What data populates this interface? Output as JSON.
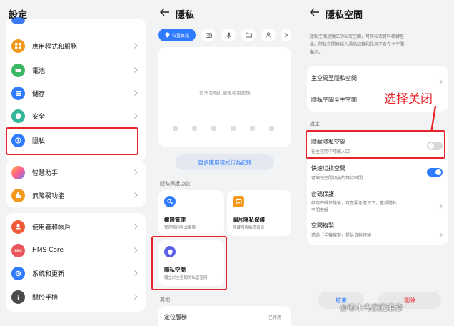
{
  "panel_settings": {
    "title": "設定",
    "items": [
      {
        "label": "應用程式和服務",
        "icon": "apps-icon",
        "color": "#f39a1e"
      },
      {
        "label": "電池",
        "icon": "battery-icon",
        "color": "#3cb763"
      },
      {
        "label": "儲存",
        "icon": "storage-icon",
        "color": "#2f7bff"
      },
      {
        "label": "安全",
        "icon": "shield-icon",
        "color": "#33b59a"
      },
      {
        "label": "隱私",
        "icon": "privacy-icon",
        "color": "#2f7bff"
      },
      {
        "label": "智慧助手",
        "icon": "assistant-icon",
        "color": "#ff6b8a"
      },
      {
        "label": "無障礙功能",
        "icon": "accessibility-icon",
        "color": "#f39a1e"
      },
      {
        "label": "使用者和帳戶",
        "icon": "user-icon",
        "color": "#ef5b3a"
      },
      {
        "label": "HMS Core",
        "icon": "hms-icon",
        "color": "#e8555b"
      },
      {
        "label": "系統和更新",
        "icon": "system-icon",
        "color": "#2f7bff"
      },
      {
        "label": "關於手機",
        "icon": "info-icon",
        "color": "#4a4a4a"
      }
    ]
  },
  "panel_privacy": {
    "title": "隱私",
    "chips": [
      {
        "label": "位置資訊",
        "icon": "location-icon"
      },
      {
        "icon": "camera-icon"
      },
      {
        "icon": "microphone-icon"
      },
      {
        "icon": "folder-icon"
      },
      {
        "icon": "contacts-icon"
      },
      {
        "icon": "chevron-right-icon"
      }
    ],
    "empty_text": "暫未發現此權限使用記錄",
    "more_button": "更多應用程式行為記錄",
    "section_protect": "隱私保護功能",
    "features": [
      {
        "title": "權限管理",
        "subtitle": "管理應用程式權限",
        "icon": "key-icon",
        "color": "#2f7bff"
      },
      {
        "title": "圖片隱私保護",
        "subtitle": "隱藏圖片敏感資訊",
        "icon": "image-icon",
        "color": "#f39a1e"
      },
      {
        "title": "隱私空間",
        "subtitle": "獨立於主空間的私密空間",
        "icon": "shield-icon",
        "color": "#5b5fe8"
      }
    ],
    "section_other": "其他",
    "location_row": {
      "label": "定位服務",
      "value": "已停用"
    }
  },
  "panel_space": {
    "title": "隱私空間",
    "intro": [
      "隱私空間是獨立的私密空間，可將私密資料移轉至",
      "此。隱私空間聯絡人通話記錄和訊息不會在主空間",
      "顯示。"
    ],
    "switch_rows": [
      "主空間至隱私空間",
      "隱私空間至主空間"
    ],
    "section_settings": "設定",
    "settings": [
      {
        "title": "隱藏隱私空間",
        "subtitle": "在主空間中隱藏入口",
        "toggle": false
      },
      {
        "title": "快速切換空間",
        "subtitle": "可縮短空間切換的等待時間",
        "toggle": true
      },
      {
        "title": "密碼保護",
        "subtitle": [
          "啟用密碼保護後，可在緊急情況下，重設隱私",
          "空間密碼"
        ]
      },
      {
        "title": "空間複製",
        "subtitle": "透過「手機複製」提供資料移轉"
      }
    ],
    "annotation": "选择关闭",
    "buttons": {
      "finish": "結束",
      "delete": "刪除"
    },
    "watermark": "@啄木鸟家庭维修"
  },
  "colors": {
    "accent": "#2f7bff",
    "highlight": "#e8242a",
    "danger": "#e8242a"
  }
}
